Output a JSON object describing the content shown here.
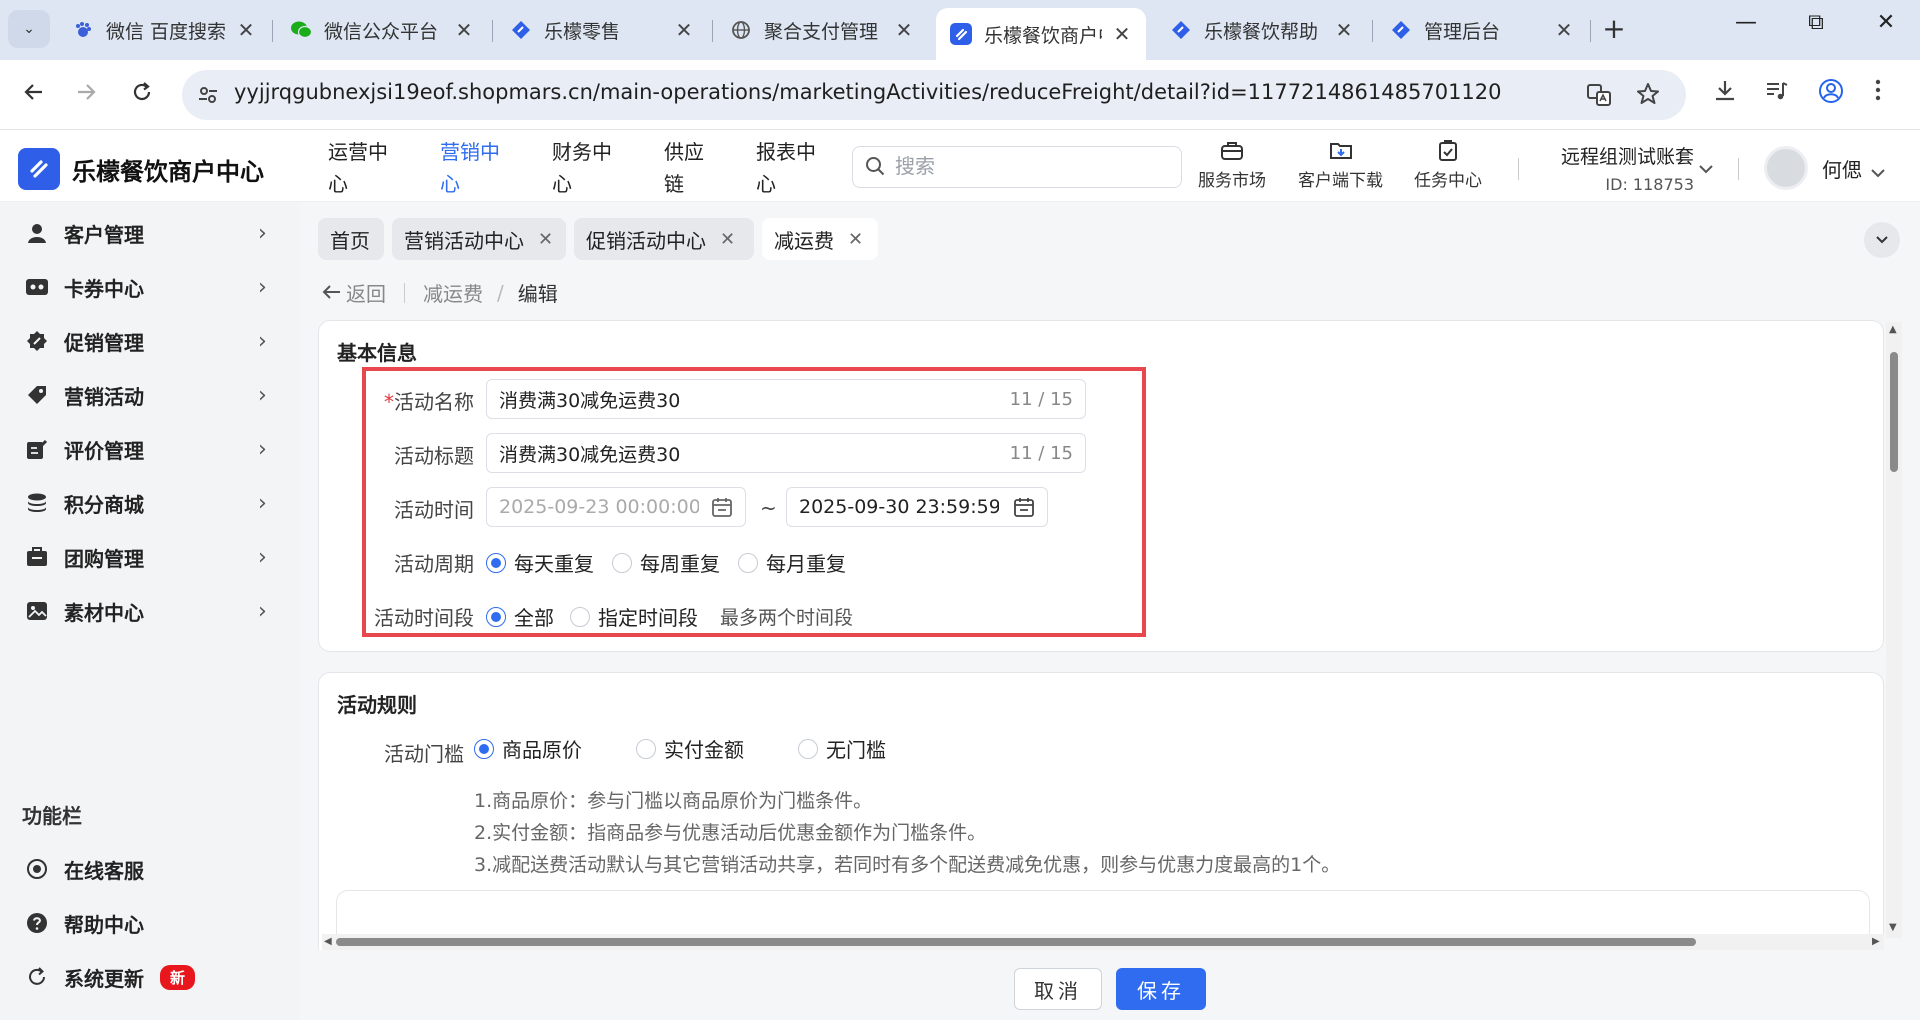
{
  "browser": {
    "tabs": [
      {
        "title": "微信 百度搜索",
        "icon": "baidu-paw-icon"
      },
      {
        "title": "微信公众平台",
        "icon": "wechat-icon"
      },
      {
        "title": "乐檬零售",
        "icon": "lemeng-diamond-icon"
      },
      {
        "title": "聚合支付管理",
        "icon": "globe-icon"
      },
      {
        "title": "乐檬餐饮商户中心",
        "icon": "lemeng-square-icon",
        "active": true
      },
      {
        "title": "乐檬餐饮帮助",
        "icon": "lemeng-diamond-icon"
      },
      {
        "title": "管理后台",
        "icon": "lemeng-diamond-icon"
      }
    ],
    "close_glyph": "✕",
    "new_tab_glyph": "+",
    "window": {
      "minimize": "—",
      "restore": "⧉",
      "close": "✕"
    },
    "url": "yyjjrqgubnexjsi19eof.shopmars.cn/main-operations/marketingActivities/reduceFreight/detail?id=1177214861485701120"
  },
  "app": {
    "brand": "乐檬餐饮商户中心",
    "brand_color": "#2f5fe8",
    "accent": "#2f6cf0",
    "nav": [
      "运营中心",
      "营销中心",
      "财务中心",
      "供应链",
      "报表中心"
    ],
    "nav_active_index": 1,
    "search_placeholder": "搜索",
    "tools": [
      {
        "label": "服务市场",
        "icon": "briefcase-icon"
      },
      {
        "label": "客户端下载",
        "icon": "download-folder-icon"
      },
      {
        "label": "任务中心",
        "icon": "clipboard-check-icon"
      }
    ],
    "account": {
      "name": "远程组测试账套",
      "id": "ID: 118753"
    },
    "user": "何偲"
  },
  "sidebar": {
    "items": [
      {
        "label": "客户管理",
        "icon": "user-icon"
      },
      {
        "label": "卡券中心",
        "icon": "coupon-icon"
      },
      {
        "label": "促销管理",
        "icon": "promotion-badge-icon"
      },
      {
        "label": "营销活动",
        "icon": "tag-icon"
      },
      {
        "label": "评价管理",
        "icon": "edit-review-icon"
      },
      {
        "label": "积分商城",
        "icon": "coins-stack-icon"
      },
      {
        "label": "团购管理",
        "icon": "group-buy-icon"
      },
      {
        "label": "素材中心",
        "icon": "image-icon"
      }
    ],
    "func_heading": "功能栏",
    "func_items": [
      {
        "label": "在线客服",
        "icon": "headset-icon"
      },
      {
        "label": "帮助中心",
        "icon": "help-circle-icon"
      },
      {
        "label": "系统更新",
        "icon": "refresh-icon",
        "badge": "新"
      }
    ]
  },
  "page_tabs": [
    {
      "label": "首页",
      "closable": false
    },
    {
      "label": "营销活动中心",
      "closable": true
    },
    {
      "label": "促销活动中心",
      "closable": true
    },
    {
      "label": "减运费",
      "closable": true,
      "active": true
    }
  ],
  "breadcrumb": {
    "back": "返回",
    "parent": "减运费",
    "current": "编辑",
    "sep": "/"
  },
  "basic": {
    "title": "基本信息",
    "name_label": "活动名称",
    "name_value": "消费满30减免运费30",
    "name_count": "11 / 15",
    "headline_label": "活动标题",
    "headline_value": "消费满30减免运费30",
    "headline_count": "11 / 15",
    "time_label": "活动时间",
    "start_placeholder": "2025-09-23 00:00:00",
    "end_value": "2025-09-30 23:59:59",
    "range_sep": "~",
    "cycle_label": "活动周期",
    "cycle_options": [
      "每天重复",
      "每周重复",
      "每月重复"
    ],
    "cycle_selected": "每天重复",
    "period_label": "活动时间段",
    "period_options": [
      "全部",
      "指定时间段"
    ],
    "period_selected": "全部",
    "period_hint": "最多两个时间段"
  },
  "rules": {
    "title": "活动规则",
    "threshold_label": "活动门槛",
    "threshold_options": [
      "商品原价",
      "实付金额",
      "无门槛"
    ],
    "threshold_selected": "商品原价",
    "notes": [
      "1.商品原价：参与门槛以商品原价为门槛条件。",
      "2.实付金额：指商品参与优惠活动后优惠金额作为门槛条件。",
      "3.减配送费活动默认与其它营销活动共享，若同时有多个配送费减免优惠，则参与优惠力度最高的1个。"
    ]
  },
  "actions": {
    "cancel": "取消",
    "save": "保存"
  }
}
